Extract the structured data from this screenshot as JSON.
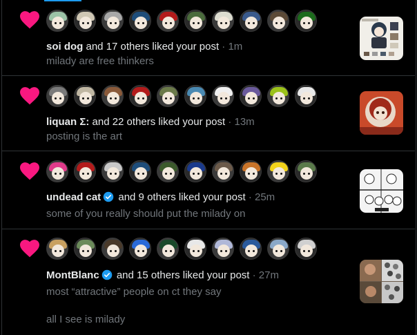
{
  "colors": {
    "heart": "#f91880",
    "verified": "#1d9bf0",
    "muted": "#71767b",
    "divider": "#2f3336"
  },
  "notifications": [
    {
      "actor": "soi dog",
      "verified": false,
      "action": "and 17 others liked your post",
      "time": "· 1m",
      "snippet": "milady are free thinkers",
      "snippet2": "",
      "avatars": [
        "#9bc2a6",
        "#cfc7b4",
        "#a8a8a8",
        "#1e4d7a",
        "#b31b1b",
        "#4a6b3c",
        "#dcdcd0",
        "#3a5a8c",
        "#5c4a36",
        "#1c6b1c"
      ]
    },
    {
      "actor": "liquan Σ:",
      "verified": false,
      "action": "and 22 others liked your post",
      "time": "· 13m",
      "snippet": "posting is the art",
      "snippet2": "",
      "avatars": [
        "#7a7a7a",
        "#c0b7a3",
        "#8a5a3a",
        "#b31b1b",
        "#6b7a4a",
        "#4a8ab3",
        "#f0f0f0",
        "#6a5a9c",
        "#9cc21a",
        "#e8e8e8"
      ]
    },
    {
      "actor": "undead cat",
      "verified": true,
      "action": "and 9 others liked your post",
      "time": "· 25m",
      "snippet": "some of you really should put the milady on",
      "snippet2": "",
      "avatars": [
        "#e03a8a",
        "#b31b1b",
        "#c8c8c8",
        "#1e4d7a",
        "#3c5a2c",
        "#1a3a8c",
        "#6b5a4a",
        "#c8742a",
        "#f2d21a",
        "#5a7a4a"
      ]
    },
    {
      "actor": "MontBlanc",
      "verified": true,
      "action": "and 15 others liked your post",
      "time": "· 27m",
      "snippet": "most “attractive” people on ct they say",
      "snippet2": "all I see is milady",
      "avatars": [
        "#c8a060",
        "#6b8a5a",
        "#4a3a2a",
        "#2a6ad8",
        "#1a4a2a",
        "#e8e8e8",
        "#b0b8d8",
        "#2a5a9c",
        "#8aa8c8",
        "#d0d0d0"
      ]
    }
  ]
}
